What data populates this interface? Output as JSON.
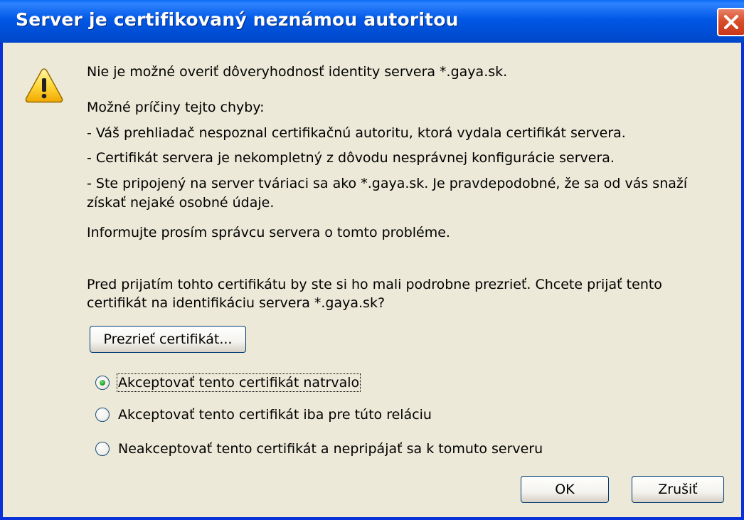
{
  "window": {
    "title": "Server je certifikovaný neznámou autoritou"
  },
  "message": {
    "intro": "Nie je možné overiť dôveryhodnosť identity servera *.gaya.sk.",
    "causes_heading": "Možné príčiny tejto chyby:",
    "cause_1": "- Váš prehliadač nespoznal certifikačnú autoritu, ktorá vydala certifikát servera.",
    "cause_2": "- Certifikát servera je nekompletný z dôvodu nesprávnej konfigurácie servera.",
    "cause_3_line1": "- Ste pripojený na server tváriaci sa ako *.gaya.sk. Je pravdepodobné, že sa od vás snaží",
    "cause_3_line2": "získať nejaké osobné údaje.",
    "inform_admin": "Informujte prosím správcu servera o tomto probléme.",
    "question_line1": "Pred prijatím tohto certifikátu by ste si ho mali podrobne prezrieť. Chcete prijať tento",
    "question_line2": "certifikát na identifikáciu servera *.gaya.sk?"
  },
  "view_cert_button": "Prezrieť certifikát...",
  "options": [
    {
      "label": "Akceptovať tento certifikát natrvalo",
      "selected": true
    },
    {
      "label": "Akceptovať tento certifikát iba pre túto reláciu",
      "selected": false
    },
    {
      "label": "Neakceptovať tento certifikát a nepripájať sa k tomuto serveru",
      "selected": false
    }
  ],
  "buttons": {
    "ok": "OK",
    "cancel": "Zrušiť"
  },
  "icons": {
    "warning": "warning-triangle-icon",
    "close": "close-icon"
  },
  "colors": {
    "titlebar": "#0058E6",
    "dialog_bg": "#ECE9D8",
    "close_button": "#D94E2B"
  }
}
